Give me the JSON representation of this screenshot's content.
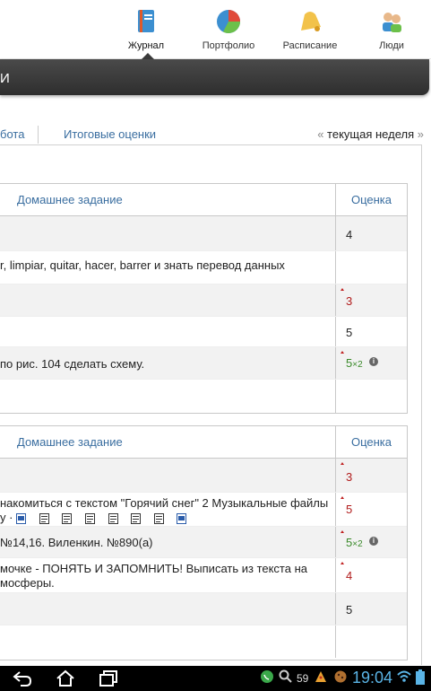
{
  "nav": {
    "items": [
      {
        "label": "Журнал",
        "icon": "journal-book-icon"
      },
      {
        "label": "Портфолио",
        "icon": "portfolio-pie-chart-icon"
      },
      {
        "label": "Расписание",
        "icon": "schedule-bell-icon"
      },
      {
        "label": "Люди",
        "icon": "people-icon"
      }
    ],
    "active": "Журнал"
  },
  "darkbar": {
    "title": "И"
  },
  "tabs": {
    "items": [
      "бота",
      "Итоговые оценки"
    ],
    "week_prefix": "«",
    "week_label": "текущая неделя",
    "week_suffix": "»"
  },
  "table1": {
    "header_homework": "Домашнее задание",
    "header_grade": "Оценка",
    "rows": [
      {
        "text": "",
        "grade": "4"
      },
      {
        "text": "r, limpiar, quitar, hacer, barrer и знать перевод данных",
        "grade": ""
      },
      {
        "text": "",
        "grade": "3"
      },
      {
        "text": "",
        "grade": "5"
      },
      {
        "text": "по рис. 104 сделать схему.",
        "grade": "5",
        "grade_mult": "×2"
      },
      {
        "text": "",
        "grade": ""
      }
    ]
  },
  "table2": {
    "header_homework": "Домашнее задание",
    "header_grade": "Оценка",
    "rows": [
      {
        "text": "",
        "grade": "3"
      },
      {
        "text_line1": "накомиться с текстом \"Горячий снег\" 2 Музыкальные файлы",
        "text_line2": "у ·",
        "grade": "5"
      },
      {
        "text": "№14,16. Виленкин. №890(а)",
        "grade": "5",
        "grade_mult": "×2"
      },
      {
        "text_line1": "мочке - ПОНЯТЬ И ЗАПОМНИТЬ! Выписать из текста на",
        "text_line2": "мосферы.",
        "grade": "4"
      },
      {
        "text": "",
        "grade": "5"
      },
      {
        "text": "",
        "grade": ""
      }
    ]
  },
  "sysbar": {
    "time": "19:04",
    "notif_count": "59"
  },
  "colors": {
    "link": "#3a6ea0",
    "grade_red": "#b11c1c",
    "grade_green": "#3a8a2a",
    "clock": "#5ab4e6"
  }
}
